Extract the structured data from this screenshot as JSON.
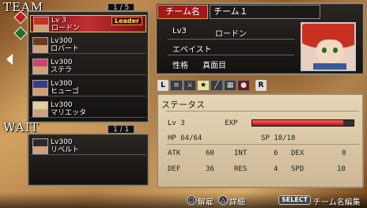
{
  "team": {
    "title": "TEAM",
    "counter": "1 / 5",
    "leader_label": "Leader",
    "members": [
      {
        "level": "Lv 3",
        "name": "ロードン",
        "hair": "#c83020"
      },
      {
        "level": "Lv300",
        "name": "ロバート",
        "hair": "#6a3a20"
      },
      {
        "level": "Lv300",
        "name": "ステラ",
        "hair": "#d04070"
      },
      {
        "level": "Lv300",
        "name": "ヒューゴ",
        "hair": "#3a3a8a"
      },
      {
        "level": "Lv300",
        "name": "マリエッタ",
        "hair": "#e0d0a0"
      }
    ]
  },
  "wait": {
    "title": "WAIT",
    "counter": "1 / 1",
    "members": [
      {
        "level": "Lv300",
        "name": "リベルト",
        "hair": "#2a2a2a"
      }
    ]
  },
  "detail": {
    "team_name_label": "チーム名",
    "team_name": "チーム１",
    "level": "Lv3",
    "name": "ロードン",
    "class": "エペイスト",
    "nature_label": "性格",
    "nature": "真面目"
  },
  "tabs": {
    "left": "L",
    "right": "R",
    "icons": [
      "list-icon",
      "sword-icon",
      "star-icon",
      "sword2-icon",
      "grid-icon",
      "pot-icon"
    ]
  },
  "status": {
    "title": "ステータス",
    "lv": "Lv 3",
    "exp_label": "EXP",
    "exp_fill": 0.9,
    "hp": "HP 64/64",
    "sp": "SP 18/18",
    "atk_l": "ATK",
    "atk": "60",
    "int_l": "INT",
    "int": "6",
    "dex_l": "DEX",
    "dex": "8",
    "def_l": "DEF",
    "def": "36",
    "res_l": "RES",
    "res": "4",
    "spd_l": "SPD",
    "spd": "10"
  },
  "footer": {
    "circle_btn": "○",
    "cancel": "解雇",
    "triangle_btn": "△",
    "detail": "詳細",
    "select_btn": "SELECT",
    "edit": "チーム名編集"
  }
}
